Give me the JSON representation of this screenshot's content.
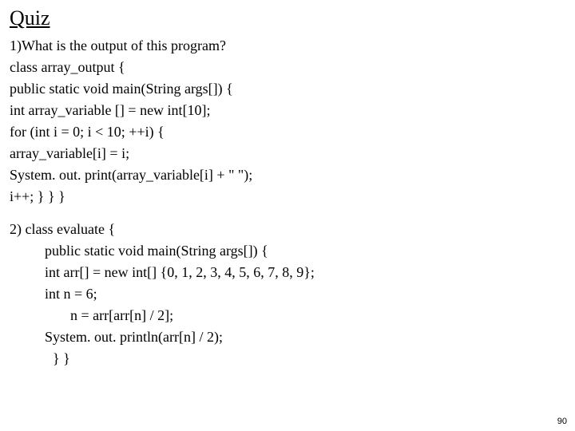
{
  "title": "Quiz",
  "q1": {
    "prompt": "1)What is the output of this program?",
    "l1": "class array_output {",
    "l2": "public static void main(String args[]) {",
    "l3": "int array_variable [] = new int[10];",
    "l4": "for (int i = 0; i < 10; ++i) {",
    "l5": "array_variable[i] = i;",
    "l6": "System. out. print(array_variable[i] + \" \");",
    "l7": "i++; }  }   }"
  },
  "q2": {
    "l1": "2) class evaluate {",
    "l2": "public static void main(String args[]) {",
    "l3": "int arr[] = new int[] {0, 1, 2, 3, 4, 5, 6, 7, 8, 9};",
    "l4": "int n = 6;",
    "l5": "n = arr[arr[n] / 2];",
    "l6": "System. out. println(arr[n] / 2);",
    "l7": "}      }"
  },
  "page_number": "90"
}
